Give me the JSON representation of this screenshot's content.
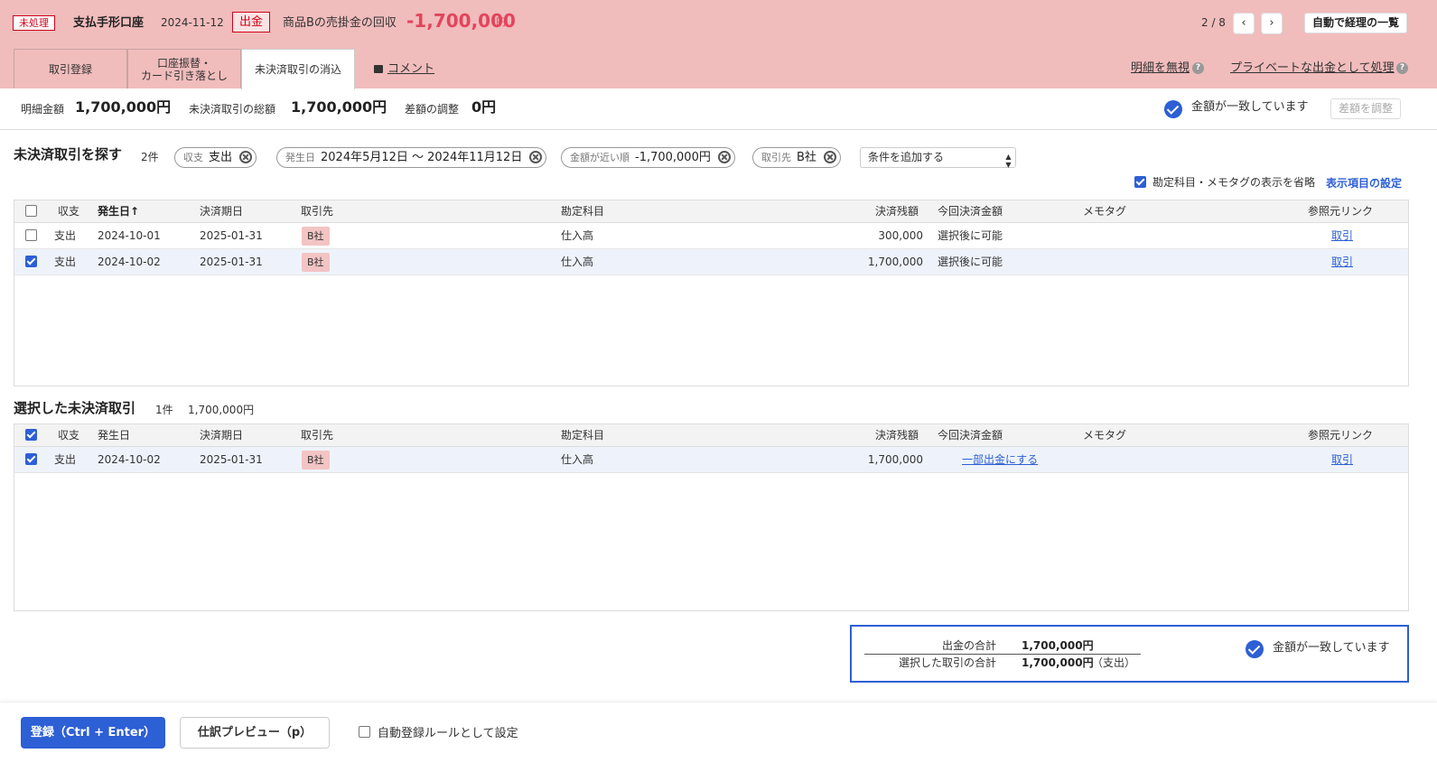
{
  "header": {
    "status_badge": "未処理",
    "account": "支払手形口座",
    "date": "2024-11-12",
    "direction_badge": "出金",
    "description": "商品Bの売掛金の回収",
    "amount": "-1,700,000",
    "amount_unit": "円",
    "pager": "2 / 8",
    "prev_icon": "‹",
    "next_icon": "›",
    "auto_list_label": "自動で経理の一覧",
    "tabs": [
      {
        "label": "取引登録"
      },
      {
        "label_line1": "口座振替・",
        "label_line2": "カード引き落とし"
      },
      {
        "label": "未決済取引の消込"
      }
    ],
    "comment_label": "コメント",
    "ignore_label": "明細を無視",
    "private_label": "プライベートな出金として処理",
    "help_glyph": "?"
  },
  "summary": {
    "detail_label": "明細金額",
    "detail_value": "1,700,000円",
    "unsettled_label": "未決済取引の総額",
    "unsettled_value": "1,700,000円",
    "diff_label": "差額の調整",
    "diff_value": "0円",
    "match_text": "金額が一致しています",
    "adjust_label": "差額を調整"
  },
  "search": {
    "title": "未決済取引を探す",
    "count": "2件",
    "chips": [
      {
        "key": "収支",
        "value": "支出"
      },
      {
        "key": "発生日",
        "value": "2024年5月12日 〜 2024年11月12日"
      },
      {
        "key": "金額が近い順",
        "value": "-1,700,000円"
      },
      {
        "key": "取引先",
        "value": "B社"
      }
    ],
    "add_condition": "条件を追加する",
    "select_arrow": "▲▼",
    "omit_label": "勘定科目・メモタグの表示を省略",
    "columns_link": "表示項目の設定"
  },
  "columns": {
    "type": "収支",
    "date": "発生日",
    "sort_arrow": "↑",
    "due": "決済期日",
    "partner": "取引先",
    "account": "勘定科目",
    "balance": "決済残額",
    "current": "今回決済金額",
    "memo": "メモタグ",
    "ref": "参照元リンク"
  },
  "results": [
    {
      "type": "支出",
      "date": "2024-10-01",
      "due": "2025-01-31",
      "partner": "B社",
      "account": "仕入高",
      "balance": "300,000",
      "current": "選択後に可能",
      "ref": "取引",
      "checked": false
    },
    {
      "type": "支出",
      "date": "2024-10-02",
      "due": "2025-01-31",
      "partner": "B社",
      "account": "仕入高",
      "balance": "1,700,000",
      "current": "選択後に可能",
      "ref": "取引",
      "checked": true
    }
  ],
  "selected": {
    "title": "選択した未決済取引",
    "count": "1件",
    "total": "1,700,000円",
    "rows": [
      {
        "type": "支出",
        "date": "2024-10-02",
        "due": "2025-01-31",
        "partner": "B社",
        "account": "仕入高",
        "balance": "1,700,000",
        "current": "一部出金にする",
        "ref": "取引",
        "checked": true
      }
    ]
  },
  "totals": {
    "out_label": "出金の合計",
    "out_value": "1,700,000円",
    "sel_label": "選択した取引の合計",
    "sel_value": "1,700,000円",
    "sel_note": "（支出）",
    "match_text": "金額が一致しています"
  },
  "footer": {
    "register_label": "登録（Ctrl + Enter）",
    "preview_label": "仕訳プレビュー（p）",
    "auto_rule_label": "自動登録ルールとして設定"
  },
  "colors": {
    "header_bg": "#f1bcbc",
    "accent": "#2d5fd5",
    "amount_red": "#e2445c"
  }
}
